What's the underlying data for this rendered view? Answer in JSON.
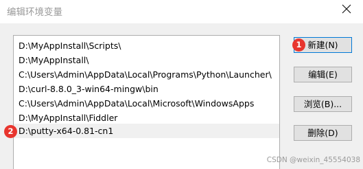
{
  "window": {
    "title": "编辑环境变量",
    "close_icon": "close-icon"
  },
  "path_list": {
    "items": [
      "D:\\MyAppInstall\\Scripts\\",
      "D:\\MyAppInstall\\",
      "C:\\Users\\Admin\\AppData\\Local\\Programs\\Python\\Launcher\\",
      "D:\\curl-8.8.0_3-win64-mingw\\bin",
      "C:\\Users\\Admin\\AppData\\Local\\Microsoft\\WindowsApps",
      "D:\\MyAppInstall\\Fiddler",
      "D:\\putty-x64-0.81-cn1"
    ],
    "selected_index": 6
  },
  "buttons": {
    "new": "新建(N)",
    "edit": "编辑(E)",
    "browse": "浏览(B)...",
    "delete": "删除(D)"
  },
  "annotations": {
    "marker_1": "1",
    "marker_2": "2",
    "color": "#e8352e"
  },
  "watermark": "CSDN @weixin_45554038",
  "colors": {
    "accent": "#0078d7",
    "selection": "#f0f0f0",
    "button_face": "#e1e1e1"
  }
}
